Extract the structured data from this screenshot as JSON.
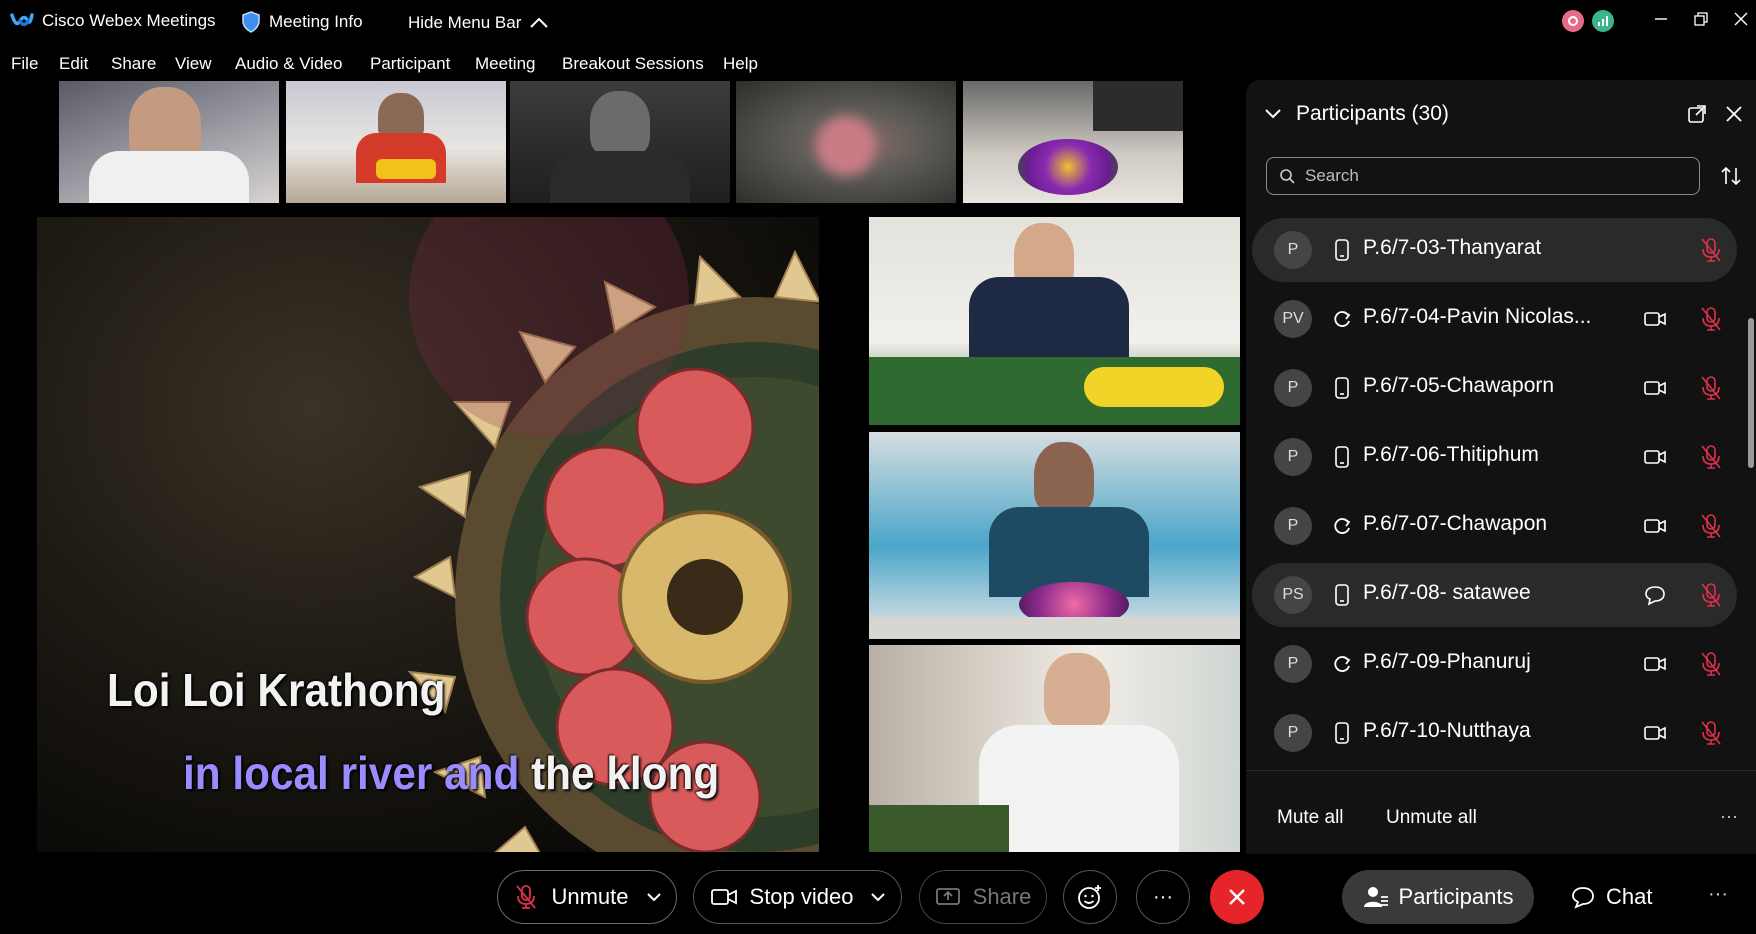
{
  "titlebar": {
    "app_title": "Cisco Webex Meetings",
    "meeting_info": "Meeting Info",
    "hide_menu": "Hide Menu Bar"
  },
  "menu": [
    "File",
    "Edit",
    "Share",
    "View",
    "Audio & Video",
    "Participant",
    "Meeting",
    "Breakout Sessions",
    "Help"
  ],
  "stage": {
    "lyric_line1": "Loi Loi Krathong",
    "lyric_line2_highlight": "in local river and",
    "lyric_line2_rest": " the klong"
  },
  "participants_panel": {
    "title": "Participants (30)",
    "search_placeholder": "Search",
    "participants": [
      {
        "initials": "P",
        "name": "P.6/7-03-Thanyarat",
        "device": "phone-icon",
        "status_icon": "",
        "muted": true
      },
      {
        "initials": "PV",
        "name": "P.6/7-04-Pavin Nicolas...",
        "device": "sync-icon",
        "status_icon": "video-icon",
        "muted": true
      },
      {
        "initials": "P",
        "name": "P.6/7-05-Chawaporn",
        "device": "phone-icon",
        "status_icon": "video-icon",
        "muted": true
      },
      {
        "initials": "P",
        "name": "P.6/7-06-Thitiphum",
        "device": "phone-icon",
        "status_icon": "video-icon",
        "muted": true
      },
      {
        "initials": "P",
        "name": "P.6/7-07-Chawapon",
        "device": "sync-icon",
        "status_icon": "video-icon",
        "muted": true
      },
      {
        "initials": "PS",
        "name": "P.6/7-08- satawee",
        "device": "phone-icon",
        "status_icon": "chat-bubble-icon",
        "muted": true
      },
      {
        "initials": "P",
        "name": "P.6/7-09-Phanuruj",
        "device": "sync-icon",
        "status_icon": "video-icon",
        "muted": true
      },
      {
        "initials": "P",
        "name": "P.6/7-10-Nutthaya",
        "device": "phone-icon",
        "status_icon": "video-icon",
        "muted": true
      }
    ],
    "mute_all": "Mute all",
    "unmute_all": "Unmute all"
  },
  "controls": {
    "unmute": "Unmute",
    "stop_video": "Stop video",
    "share": "Share",
    "more": "···",
    "participants": "Participants",
    "chat": "Chat"
  },
  "colors": {
    "leave_red": "#e5252a",
    "mute_red": "#e0314b",
    "panel_bg": "#121212",
    "status_pink": "#e86a8a",
    "status_green": "#3bb58c"
  }
}
